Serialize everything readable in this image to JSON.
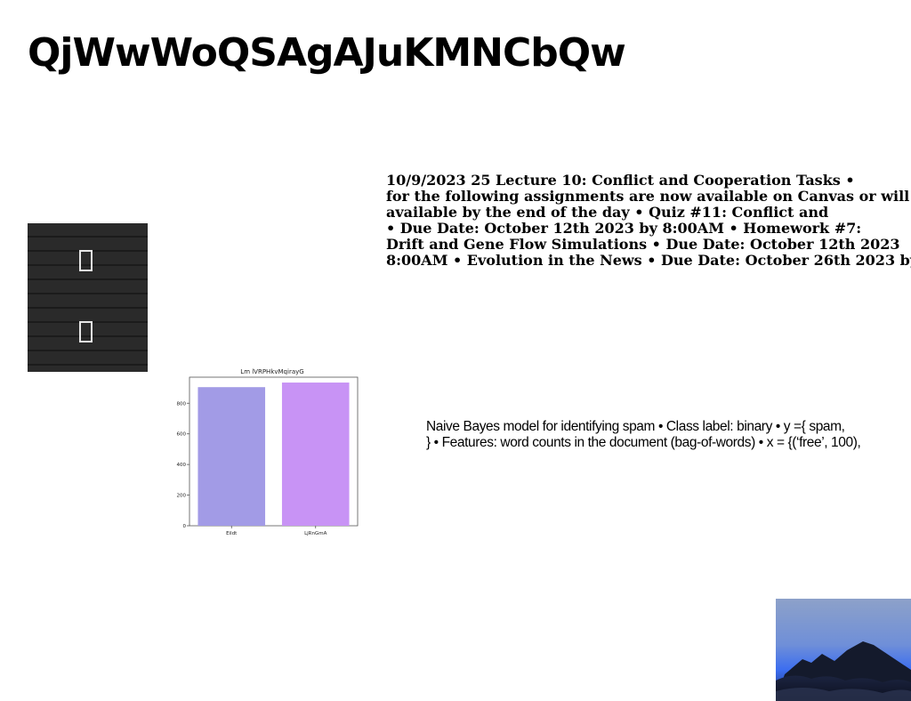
{
  "title": "QjWwWoQSAgAJuKMNCbQw",
  "lecture_text": {
    "lines": [
      "10/9/2023 25 Lecture 10: Conflict and Cooperation Tasks •",
      "for the following assignments are now available on Canvas or will",
      "available by the end of the day • Quiz #11: Conflict and",
      "• Due Date: October 12th 2023 by 8:00AM • Homework #7:",
      "Drift and Gene Flow Simulations • Due Date: October 12th 2023",
      "8:00AM • Evolution in the News • Due Date: October 26th 2023 by"
    ]
  },
  "spam_text": {
    "lines": [
      "Naive Bayes model for identifying spam • Class label: binary • y ={ spam,",
      "} • Features: word counts in the document (bag-of-words) • x = {(‘free’, 100),"
    ]
  },
  "dark_image": {
    "icon": "missing-glyph-box"
  },
  "photo": {
    "subject": "mountain-silhouette-at-dusk"
  },
  "chart_data": {
    "type": "bar",
    "title": "Lm lVRPHkvMqirayG",
    "categories": [
      "Eildt",
      "LjRnGmA"
    ],
    "values": [
      905,
      935
    ],
    "colors": [
      "#a29be6",
      "#c893f5"
    ],
    "ylim": [
      0,
      970
    ],
    "yticks": [
      0,
      200,
      400,
      600,
      800
    ],
    "xlabel": "",
    "ylabel": "",
    "grid": false
  }
}
